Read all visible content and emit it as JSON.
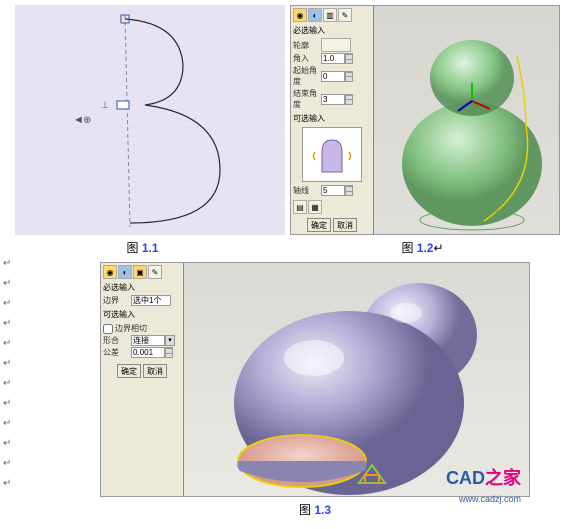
{
  "captions": {
    "f11_prefix": "图 ",
    "f11_num": "1.1",
    "f12_prefix": "图 ",
    "f12_num": "1.2",
    "f13_prefix": "图 ",
    "f13_num": "1.3",
    "arrow_suffix": "↵"
  },
  "panel12": {
    "section1": "必选输入",
    "fields": {
      "section_label": "轮廓",
      "angle_label": "角入",
      "angle_val": "1.0",
      "start_ang_label": "起始角度",
      "start_ang_val": "0",
      "end_ang_label": "结束角度",
      "end_ang_val": "3"
    },
    "section2": "可选输入",
    "axis_label": "轴线",
    "axis_val": "5",
    "ok": "确定",
    "cancel": "取消"
  },
  "panel13": {
    "section1": "必选输入",
    "edge_label": "边界",
    "edge_val": "选中1个",
    "section2": "可选输入",
    "chk_label": "边界相切",
    "join_label": "形合",
    "join_val": "连接",
    "tol_label": "公差",
    "tol_val": "0.001",
    "ok": "确定",
    "cancel": "取消"
  },
  "axis_markers": {
    "x_arrow": "◄",
    "center": "⊕"
  },
  "watermark": {
    "cad": "CAD",
    "zhj": "之家",
    "url": "www.cadzj.com"
  }
}
